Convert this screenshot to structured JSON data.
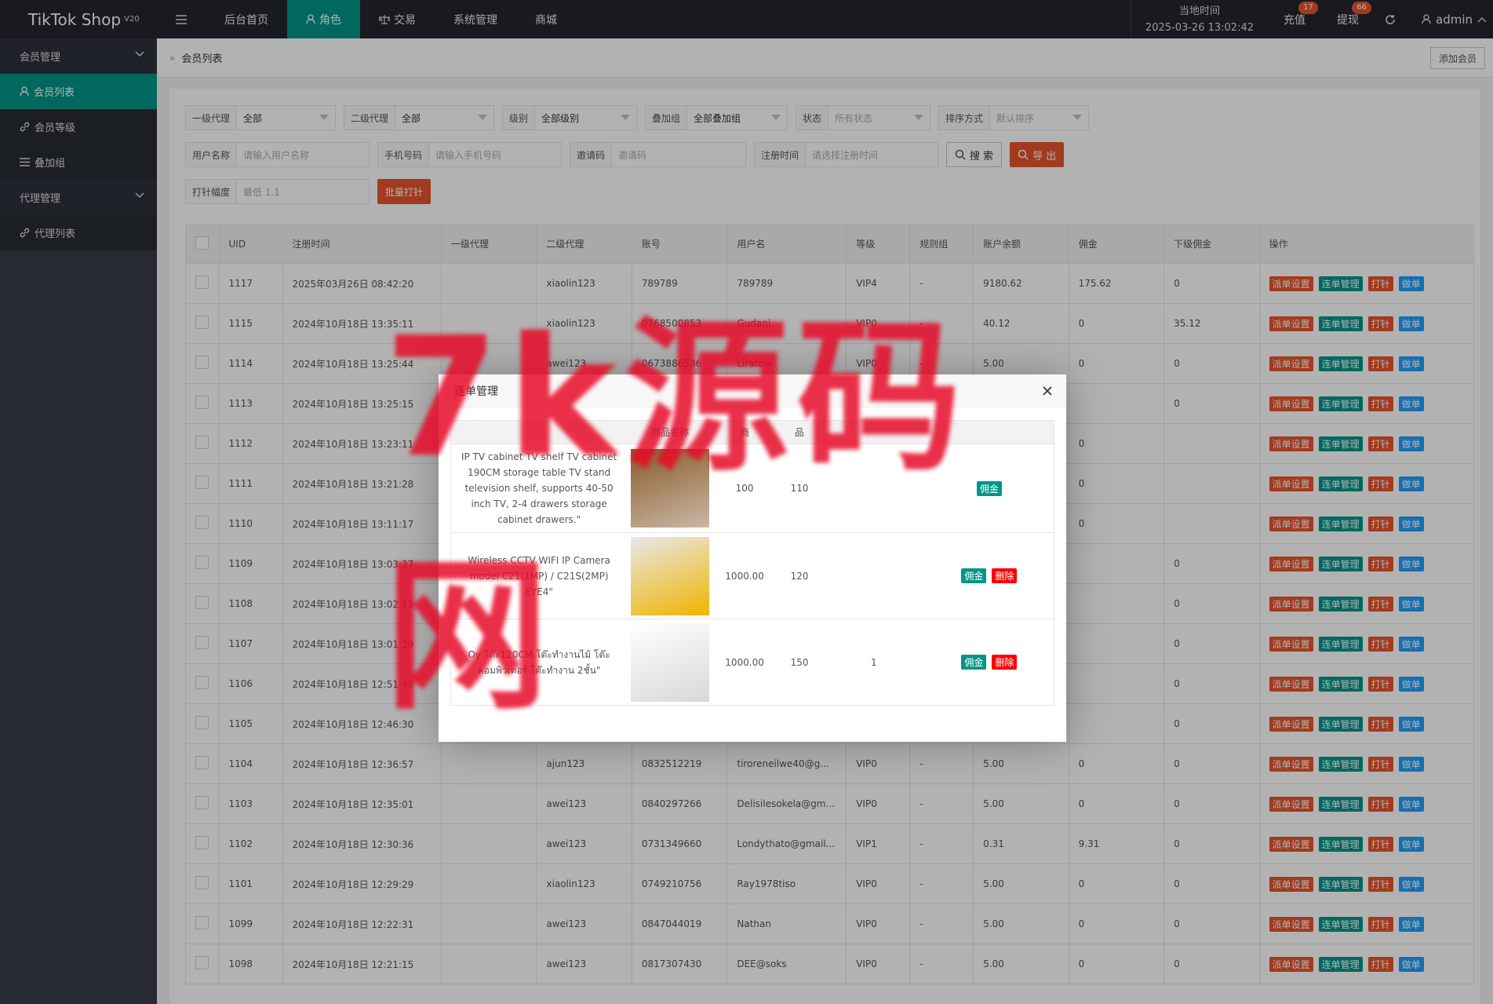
{
  "app": {
    "name": "TikTok Shop",
    "version": "V20"
  },
  "topnav": [
    {
      "label": "后台首页",
      "icon": "menu-icon"
    },
    {
      "label": "角色",
      "icon": "user-icon",
      "active": true
    },
    {
      "label": "交易",
      "icon": "scale-icon"
    },
    {
      "label": "系统管理"
    },
    {
      "label": "商城"
    }
  ],
  "clock": {
    "label": "当地时间",
    "value": "2025-03-26 13:02:42"
  },
  "topright": {
    "recharge": {
      "label": "充值",
      "badge": "17"
    },
    "withdraw": {
      "label": "提现",
      "badge": "66"
    },
    "user": "admin"
  },
  "sidebar": [
    {
      "label": "会员管理",
      "type": "group"
    },
    {
      "label": "会员列表",
      "type": "sub",
      "active": true,
      "icon": "user-icon"
    },
    {
      "label": "会员等级",
      "type": "sub",
      "icon": "link-icon"
    },
    {
      "label": "叠加组",
      "type": "sub",
      "icon": "list-icon"
    },
    {
      "label": "代理管理",
      "type": "group"
    },
    {
      "label": "代理列表",
      "type": "sub",
      "icon": "link-icon"
    }
  ],
  "breadcrumb": {
    "current": "会员列表",
    "add_button": "添加会员"
  },
  "filters": {
    "row1": [
      {
        "label": "一级代理",
        "value": "全部",
        "select": true,
        "width": 192
      },
      {
        "label": "二级代理",
        "value": "全部",
        "select": true,
        "width": 192
      },
      {
        "label": "级别",
        "value": "全部级别",
        "select": true,
        "width": 172
      },
      {
        "label": "叠加组",
        "value": "全部叠加组",
        "select": true,
        "width": 182
      },
      {
        "label": "状态",
        "placeholder": "所有状态",
        "select": true,
        "width": 172
      },
      {
        "label": "排序方式",
        "placeholder": "默认排序",
        "select": true,
        "width": 192
      }
    ],
    "row2": [
      {
        "label": "用户名称",
        "placeholder": "请输入用户名称",
        "width": 235
      },
      {
        "label": "手机号码",
        "placeholder": "请输入手机号码",
        "width": 235
      },
      {
        "label": "邀请码",
        "placeholder": "邀请码",
        "width": 225
      },
      {
        "label": "注册时间",
        "placeholder": "请选择注册时间",
        "width": 235
      }
    ],
    "search_label": "搜 索",
    "export_label": "导 出",
    "row3": {
      "label": "打针幅度",
      "placeholder": "最低 1.1",
      "button": "批量打针"
    }
  },
  "table": {
    "columns": [
      "UID",
      "注册时间",
      "一级代理",
      "二级代理",
      "账号",
      "用户名",
      "等级",
      "规则组",
      "账户余额",
      "佣金",
      "下级佣金",
      "操作"
    ],
    "actions": [
      "派单设置",
      "连单管理",
      "打针",
      "做单"
    ],
    "rows": [
      [
        "1117",
        "2025年03月26日 08:42:20",
        "",
        "xiaolin123",
        "789789",
        "789789",
        "VIP4",
        "-",
        "9180.62",
        "175.62",
        "0"
      ],
      [
        "1115",
        "2024年10月18日 13:35:11",
        "",
        "xiaolin123",
        "0768500853",
        "Gudani",
        "VIP0",
        "-",
        "40.12",
        "0",
        "35.12"
      ],
      [
        "1114",
        "2024年10月18日 13:25:44",
        "",
        "awei123",
        "0673886536",
        "Liratow",
        "VIP0",
        "-",
        "5.00",
        "0",
        "0"
      ],
      [
        "1113",
        "2024年10月18日 13:25:15",
        "",
        "",
        "",
        "",
        "",
        "",
        "",
        "",
        "0"
      ],
      [
        "1112",
        "2024年10月18日 13:23:11",
        "",
        "",
        "",
        "",
        "",
        "",
        "",
        "0",
        ""
      ],
      [
        "1111",
        "2024年10月18日 13:21:28",
        "",
        "",
        "",
        "",
        "",
        "",
        "",
        "0",
        ""
      ],
      [
        "1110",
        "2024年10月18日 13:11:17",
        "",
        "",
        "",
        "",
        "",
        "",
        "",
        "0",
        ""
      ],
      [
        "1109",
        "2024年10月18日 13:03:37",
        "",
        "",
        "",
        "",
        "",
        "",
        "",
        "",
        "0"
      ],
      [
        "1108",
        "2024年10月18日 13:02:11",
        "",
        "",
        "",
        "",
        "",
        "",
        "",
        "",
        "0"
      ],
      [
        "1107",
        "2024年10月18日 13:01:29",
        "",
        "",
        "",
        "",
        "",
        "",
        "",
        "",
        "0"
      ],
      [
        "1106",
        "2024年10月18日 12:51:46",
        "",
        "",
        "",
        "",
        "",
        "",
        "",
        "",
        "0"
      ],
      [
        "1105",
        "2024年10月18日 12:46:30",
        "",
        "",
        "",
        "",
        "",
        "",
        "",
        "",
        "0"
      ],
      [
        "1104",
        "2024年10月18日 12:36:57",
        "",
        "ajun123",
        "0832512219",
        "tiroreneilwe40@g...",
        "VIP0",
        "-",
        "5.00",
        "0",
        "0"
      ],
      [
        "1103",
        "2024年10月18日 12:35:01",
        "",
        "awei123",
        "0840297266",
        "Delisilesokela@gm...",
        "VIP0",
        "-",
        "5.00",
        "0",
        "0"
      ],
      [
        "1102",
        "2024年10月18日 12:30:36",
        "",
        "awei123",
        "0731349660",
        "Londythato@gmail...",
        "VIP1",
        "-",
        "0.31",
        "9.31",
        "0"
      ],
      [
        "1101",
        "2024年10月18日 12:29:29",
        "",
        "xiaolin123",
        "0749210756",
        "Ray1978tiso",
        "VIP0",
        "-",
        "5.00",
        "0",
        "0"
      ],
      [
        "1099",
        "2024年10月18日 12:22:31",
        "",
        "awei123",
        "0847044019",
        "Nathan",
        "VIP0",
        "-",
        "5.00",
        "0",
        "0"
      ],
      [
        "1098",
        "2024年10月18日 12:21:15",
        "",
        "awei123",
        "0817307430",
        "DEE@soks",
        "VIP0",
        "-",
        "5.00",
        "0",
        "0"
      ]
    ]
  },
  "modal": {
    "title": "连单管理",
    "columns": [
      "商品名称",
      "商",
      "品",
      "",
      ""
    ],
    "rows": [
      {
        "name": "IP TV cabinet TV shelf TV cabinet 190CM storage table TV stand television shelf, supports 40-50 inch TV, 2-4 drawers storage cabinet drawers.\"",
        "price": "100",
        "qty": "110",
        "num": "",
        "btn": "佣金",
        "del": ""
      },
      {
        "name": "Wireless CCTV WIFI IP Camera model C21(1MP) / C21S(2MP) EYE4\"",
        "price": "1000.00",
        "qty": "120",
        "num": "",
        "btn": "佣金",
        "del": "删除"
      },
      {
        "name": "Oy โต๊ะ120CM โต๊ะทำงานไม้ โต๊ะคอมพิวเตอร์ โต๊ะทำงาน 2ชั้น\"",
        "price": "1000.00",
        "qty": "150",
        "num": "1",
        "btn": "佣金",
        "del": "删除"
      }
    ]
  },
  "watermark": "7k源码网"
}
